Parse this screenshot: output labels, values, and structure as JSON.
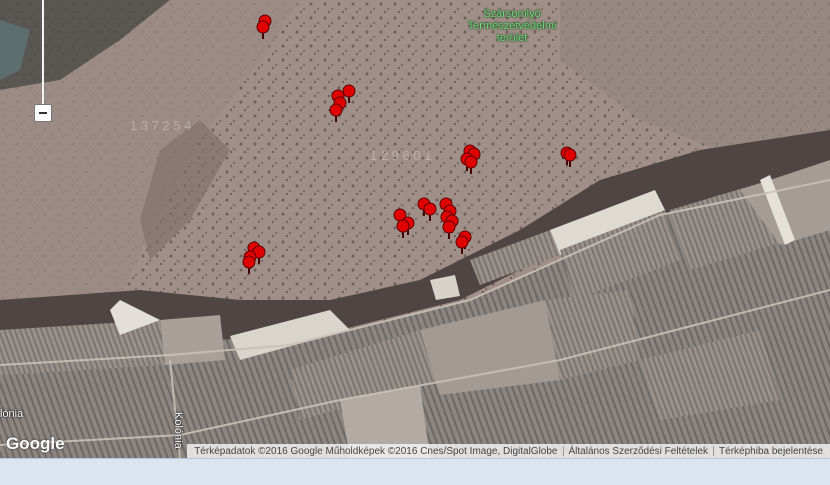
{
  "map": {
    "area_label": [
      "Szársomlyó",
      "Természetvédelmi",
      "terület"
    ],
    "road_label_left": "lónia",
    "road_label_vertical": "Kolónia",
    "logo": "Google",
    "attribution": {
      "data": "Térképadatok ©2016 Google Műholdképek ©2016 Cnes/Spot Image, DigitalGlobe",
      "terms": "Általános Szerződési Feltételek",
      "report": "Térképhiba bejelentése"
    },
    "zoom_out_symbol": "−",
    "marker_color": "#e00000",
    "icons": {
      "zoom": "minus-icon",
      "marker": "map-pin-icon"
    }
  }
}
